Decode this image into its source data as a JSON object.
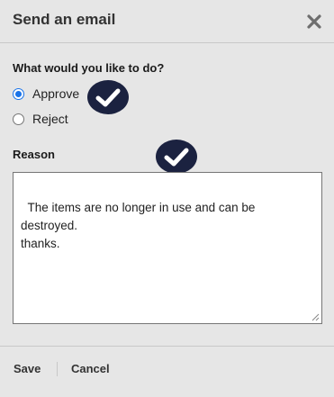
{
  "dialog": {
    "title": "Send an email",
    "close_icon": "close-x-icon"
  },
  "action": {
    "question": "What would you like to do?",
    "options": [
      {
        "label": "Approve",
        "selected": true
      },
      {
        "label": "Reject",
        "selected": false
      }
    ]
  },
  "reason": {
    "label": "Reason",
    "value": "The items are no longer in use and can be destroyed.\nthanks."
  },
  "footer": {
    "save_label": "Save",
    "cancel_label": "Cancel"
  },
  "annotations": {
    "icon": "checkmark-badge-icon",
    "badge_color": "#1b2240"
  },
  "colors": {
    "background": "#e6e6e6",
    "accent": "#1a73e8"
  }
}
